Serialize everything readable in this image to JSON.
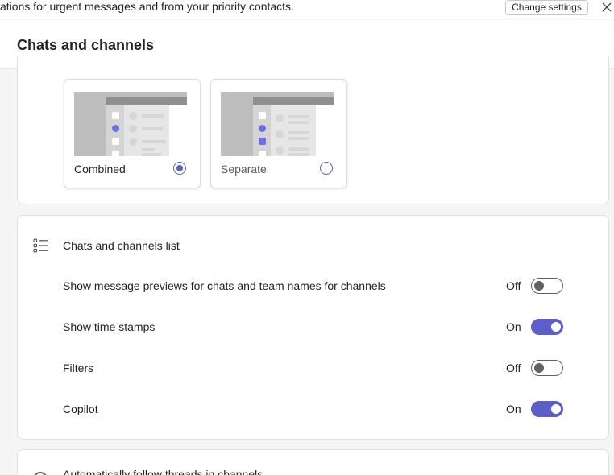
{
  "banner": {
    "text": "ations for urgent messages and from your priority contacts.",
    "change_settings_label": "Change settings"
  },
  "header": {
    "title": "Chats and channels"
  },
  "layout_options": {
    "combined": {
      "label": "Combined",
      "selected": true
    },
    "separate": {
      "label": "Separate",
      "selected": false
    }
  },
  "chats_list": {
    "title": "Chats and channels list",
    "rows": [
      {
        "label": "Show message previews for chats and team names for channels",
        "state": "Off"
      },
      {
        "label": "Show time stamps",
        "state": "On"
      },
      {
        "label": "Filters",
        "state": "Off"
      },
      {
        "label": "Copilot",
        "state": "On"
      }
    ]
  },
  "follow_threads": {
    "title": "Automatically follow threads in channels"
  },
  "colors": {
    "accent": "#5b5fc7",
    "toggle_off": "#616161",
    "background": "#f5f5f5"
  }
}
